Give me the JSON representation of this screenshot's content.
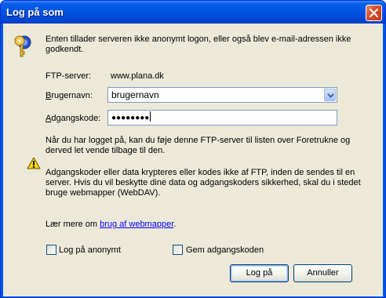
{
  "window": {
    "title": "Log på som"
  },
  "intro_text": "Enten tillader serveren ikke anonymt logon, eller også blev e-mail-adressen ikke godkendt.",
  "ftp_server": {
    "label": "FTP-server:",
    "value": "www.plana.dk"
  },
  "username": {
    "label": "Brugernavn:",
    "value": "brugernavn"
  },
  "password": {
    "label": "Adgangskode:",
    "masked_value": "●●●●●●●●"
  },
  "favorites_text": "Når du har logget på, kan du føje denne FTP-server til listen over Foretrukne og derved let vende tilbage til den.",
  "warning_text": "Adgangskoder eller data krypteres eller kodes ikke af FTP, inden de sendes til en server. Hvis du vil beskytte dine data og adgangskoders sikkerhed, skal du i stedet bruge webmapper (WebDAV).",
  "learn_more": {
    "prefix": "Lær mere om ",
    "link": "brug af webmapper",
    "suffix": "."
  },
  "checkboxes": {
    "anonymous": "Log på anonymt",
    "save_password": "Gem adgangskoden"
  },
  "buttons": {
    "login": "Log på",
    "cancel": "Annuller"
  },
  "icons": {
    "title_close": "close-icon",
    "credentials": "key-icon",
    "warning": "warning-icon",
    "dropdown": "chevron-down-icon"
  }
}
